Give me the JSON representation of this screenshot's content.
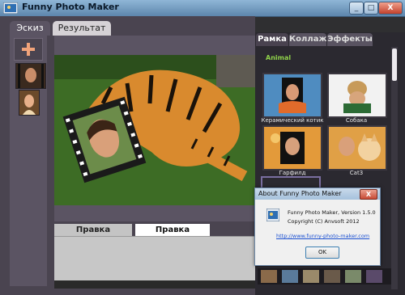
{
  "window": {
    "title": "Funny Photo Maker",
    "min_label": "_",
    "max_label": "□",
    "close_label": "X"
  },
  "main_tabs": [
    {
      "label": "Эскиз",
      "active": true
    },
    {
      "label": "Результат",
      "active": false
    }
  ],
  "edit_tabs": [
    {
      "label": "Правка оригинала",
      "active": false
    },
    {
      "label": "Правка шаблона",
      "active": true
    }
  ],
  "right_tabs": [
    {
      "label": "Рамка",
      "active": true
    },
    {
      "label": "Коллаж",
      "active": false
    },
    {
      "label": "Эффекты",
      "active": false
    }
  ],
  "frames": {
    "section_title": "Animal",
    "items": [
      {
        "label": "Керамический котик"
      },
      {
        "label": "Собака"
      },
      {
        "label": "Гарфилд"
      },
      {
        "label": "Cat3"
      }
    ]
  },
  "about_dialog": {
    "title": "About Funny Photo Maker",
    "close_label": "X",
    "version_line": "Funny Photo Maker, Version 1.5.0",
    "copyright_line": "Copyright (C) Anvsoft 2012",
    "link": "http://www.funny-photo-maker.com",
    "ok_label": "OK"
  },
  "colors": {
    "accent_green": "#8fd24a",
    "title_gradient_top": "#8fb6d6",
    "link_blue": "#1a4fd1"
  }
}
